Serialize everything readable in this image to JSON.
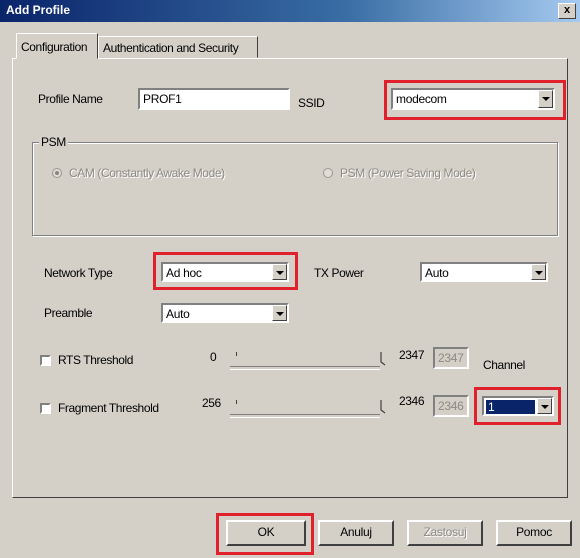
{
  "window": {
    "title": "Add Profile",
    "close_glyph": "x"
  },
  "tabs": [
    {
      "label": "Configuration",
      "active": true
    },
    {
      "label": "Authentication and Security",
      "active": false
    }
  ],
  "profile": {
    "profile_name_label": "Profile Name",
    "profile_name_value": "PROF1",
    "ssid_label": "SSID",
    "ssid_value": "modecom"
  },
  "psm": {
    "group_label": "PSM",
    "option_cam": "CAM (Constantly Awake Mode)",
    "option_psm": "PSM (Power Saving Mode)",
    "selected": "CAM"
  },
  "network": {
    "network_type_label": "Network Type",
    "network_type_value": "Ad hoc",
    "tx_power_label": "TX Power",
    "tx_power_value": "Auto",
    "preamble_label": "Preamble",
    "preamble_value": "Auto"
  },
  "rts": {
    "label": "RTS Threshold",
    "checked": false,
    "min": "0",
    "max": "2347",
    "value": "2347"
  },
  "fragment": {
    "label": "Fragment Threshold",
    "checked": false,
    "min": "256",
    "max": "2346",
    "value": "2346"
  },
  "channel": {
    "label": "Channel",
    "value": "1"
  },
  "buttons": {
    "ok": "OK",
    "cancel": "Anuluj",
    "apply": "Zastosuj",
    "help": "Pomoc"
  },
  "colors": {
    "highlight": "#e0202a",
    "titlebar": "#0a246a",
    "face": "#d4d0c8"
  }
}
